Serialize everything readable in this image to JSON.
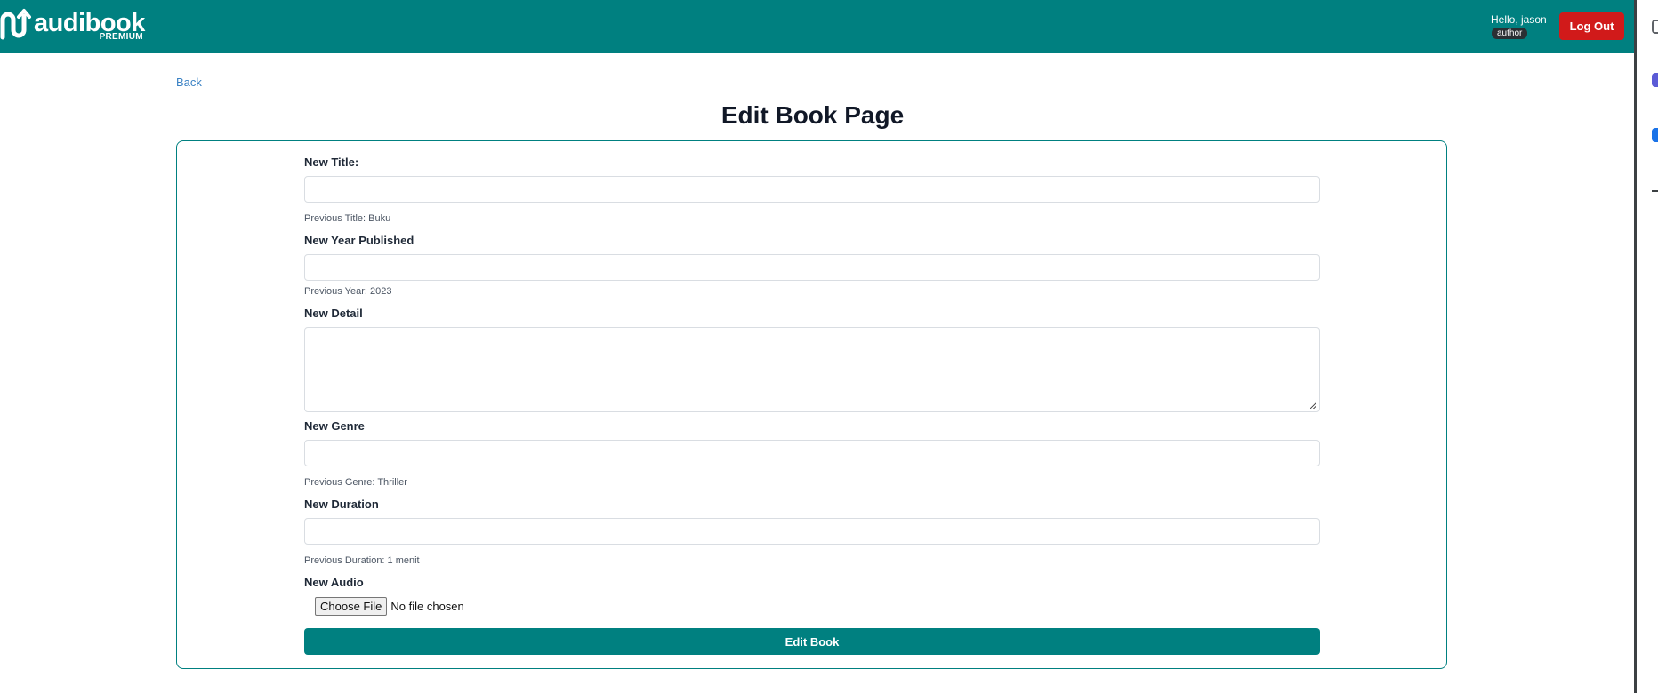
{
  "header": {
    "logo_text": "audibook",
    "logo_sub": "PREMIUM",
    "greeting": "Hello, jason",
    "role": "author",
    "logout_label": "Log Out",
    "brand_color": "#008080",
    "logout_color": "#d11a1a"
  },
  "nav": {
    "back_label": "Back"
  },
  "page": {
    "title": "Edit Book Page"
  },
  "form": {
    "title_label": "New Title:",
    "title_value": "",
    "title_hint": "Previous Title: Buku",
    "year_label": "New Year Published",
    "year_value": "",
    "year_hint": "Previous Year: 2023",
    "detail_label": "New Detail",
    "detail_value": "",
    "genre_label": "New Genre",
    "genre_value": "",
    "genre_hint": "Previous Genre: Thriller",
    "duration_label": "New Duration",
    "duration_value": "",
    "duration_hint": "Previous Duration: 1 menit",
    "audio_label": "New Audio",
    "choose_file_label": "Choose File",
    "file_status": "No file chosen",
    "submit_label": "Edit Book"
  }
}
